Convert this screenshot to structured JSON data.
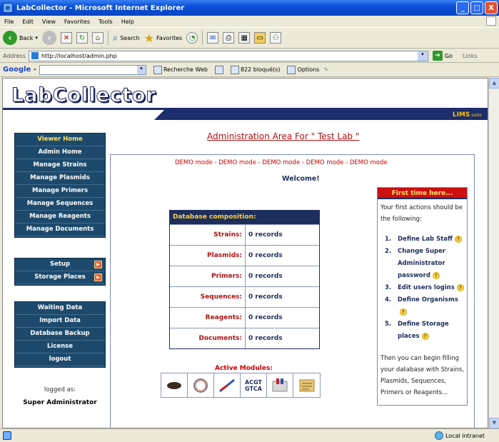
{
  "window": {
    "title": "LabCollector - Microsoft Internet Explorer",
    "icon": "ie-icon",
    "buttons": [
      "_",
      "□",
      "X"
    ]
  },
  "menubar": [
    "File",
    "Edit",
    "View",
    "Favorites",
    "Tools",
    "Help"
  ],
  "toolbar": {
    "back_label": "Back",
    "search_label": "Search",
    "favorites_label": "Favorites"
  },
  "address": {
    "label": "Address",
    "url": "http://localhost/admin.php",
    "go_label": "Go",
    "links_label": "Links"
  },
  "googlebar": {
    "logo": "Google -",
    "search_web": "Recherche Web",
    "blocked": "822 bloqué(s)",
    "options": "Options"
  },
  "banner": {
    "logo_text": "LabCollector",
    "lims_text": "LIMS",
    "lims_suffix": "suite"
  },
  "sidebar": {
    "group1": [
      "Viewer Home",
      "Admin Home",
      "Manage Strains",
      "Manage Plasmids",
      "Manage Primers",
      "Manage Sequences",
      "Manage Reagents",
      "Manage Documents"
    ],
    "group2": [
      "Setup",
      "Storage Places"
    ],
    "group3": [
      "Waiting Data",
      "Import Data",
      "Database Backup",
      "License",
      "logout"
    ],
    "logged_as_label": "logged as:",
    "logged_user": "Super Administrator"
  },
  "main": {
    "title": "Administration Area For \" Test Lab \"",
    "demo_text": "DEMO mode - DEMO mode - DEMO mode - DEMO mode - DEMO mode",
    "welcome": "Welcome!"
  },
  "db_table": {
    "header": "Database composition:",
    "rows": [
      {
        "label": "Strains:",
        "value": "0 records"
      },
      {
        "label": "Plasmids:",
        "value": "0 records"
      },
      {
        "label": "Primers:",
        "value": "0 records"
      },
      {
        "label": "Sequences:",
        "value": "0 records"
      },
      {
        "label": "Reagents:",
        "value": "0 records"
      },
      {
        "label": "Documents:",
        "value": "0 records"
      }
    ]
  },
  "modules": {
    "title": "Active Modules:",
    "icons": [
      "strain-icon",
      "plasmid-icon",
      "primer-icon",
      "sequence-icon",
      "reagent-icon",
      "document-icon"
    ],
    "sequence_text": "ACGT GTCA"
  },
  "first_time": {
    "header": "First time here...",
    "intro": "Your first actions should be the following:",
    "steps": [
      {
        "num": "1.",
        "text": "Define Lab Staff"
      },
      {
        "num": "2.",
        "text": "Change Super Administrator password"
      },
      {
        "num": "3.",
        "text": "Edit users logins"
      },
      {
        "num": "4.",
        "text": "Define Organisms"
      },
      {
        "num": "5.",
        "text": "Define Storage places"
      }
    ],
    "outro": "Then you can begin filling your database with Strains, Plasmids, Sequences, Primers or Reagents..."
  },
  "statusbar": {
    "zone": "Local intranet"
  },
  "colors": {
    "nav_bg": "#1d4a6c",
    "header_blue": "#1d2e5c",
    "accent_red": "#cc1010",
    "lims_yellow": "#ffc400"
  }
}
